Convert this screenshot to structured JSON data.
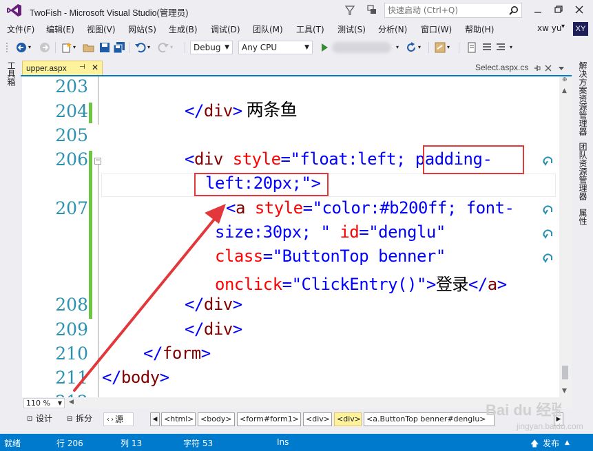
{
  "window": {
    "title": "TwoFish - Microsoft Visual Studio(管理员)",
    "quick_launch_placeholder": "快速启动 (Ctrl+Q)"
  },
  "menu": [
    "文件(F)",
    "编辑(E)",
    "视图(V)",
    "网站(S)",
    "生成(B)",
    "调试(D)",
    "团队(M)",
    "工具(T)",
    "测试(S)",
    "分析(N)",
    "窗口(W)",
    "帮助(H)"
  ],
  "user": {
    "name": "xw yu",
    "initials": "XY"
  },
  "toolbar": {
    "config": "Debug",
    "platform": "Any CPU"
  },
  "left_strip": {
    "toolbox": "工具箱"
  },
  "right_strip": {
    "solution_explorer": "解决方案资源管理器",
    "team_explorer": "团队资源管理器",
    "properties": "属性"
  },
  "tabs": {
    "active": "upper.aspx",
    "other": "Select.aspx.cs"
  },
  "editor": {
    "line_numbers": [
      "203",
      "204",
      "205",
      "206",
      "207",
      "208",
      "209",
      "210",
      "211"
    ],
    "line_203_text": "两条鱼",
    "tokens": {
      "lt": "<",
      "lt_slash": "</",
      "gt": ">",
      "div": "div",
      "a": "a",
      "form": "form",
      "body": "body",
      "style": "style",
      "id": "id",
      "class": "class",
      "onclick": "onclick",
      "eq": "=",
      "style_val_part1": "\"float:left; padding-",
      "style_val_part2": "left:20px;\"",
      "a_style_val_part1": "\"color:#b200ff; font-",
      "a_style_val_part2": "size:30px; \"",
      "id_val": "\"denglu\"",
      "class_val": "\"ButtonTop benner\"",
      "onclick_val": "\"ClickEntry()\"",
      "login_text": "登录"
    }
  },
  "zoom": "110 %",
  "view_tabs": {
    "design": "设计",
    "split": "拆分",
    "source": "源"
  },
  "breadcrumbs": [
    "<html>",
    "<body>",
    "<form#form1>",
    "<div>",
    "<div>",
    "<a.ButtonTop benner#denglu>"
  ],
  "status": {
    "state": "就绪",
    "line": "行 206",
    "col": "列 13",
    "char": "字符 53",
    "mode": "Ins",
    "publish": "发布"
  },
  "watermark": {
    "logo_text": "Bai du 经验",
    "url": "jingyan.baidu.com"
  },
  "colors": {
    "accent": "#007acc",
    "line_number": "#2b91af",
    "html_delimiter": "#0000ff",
    "html_tag": "#800000",
    "html_attr": "#ff0000",
    "annotation": "#e2383c",
    "changed_line": "#6cc644"
  }
}
